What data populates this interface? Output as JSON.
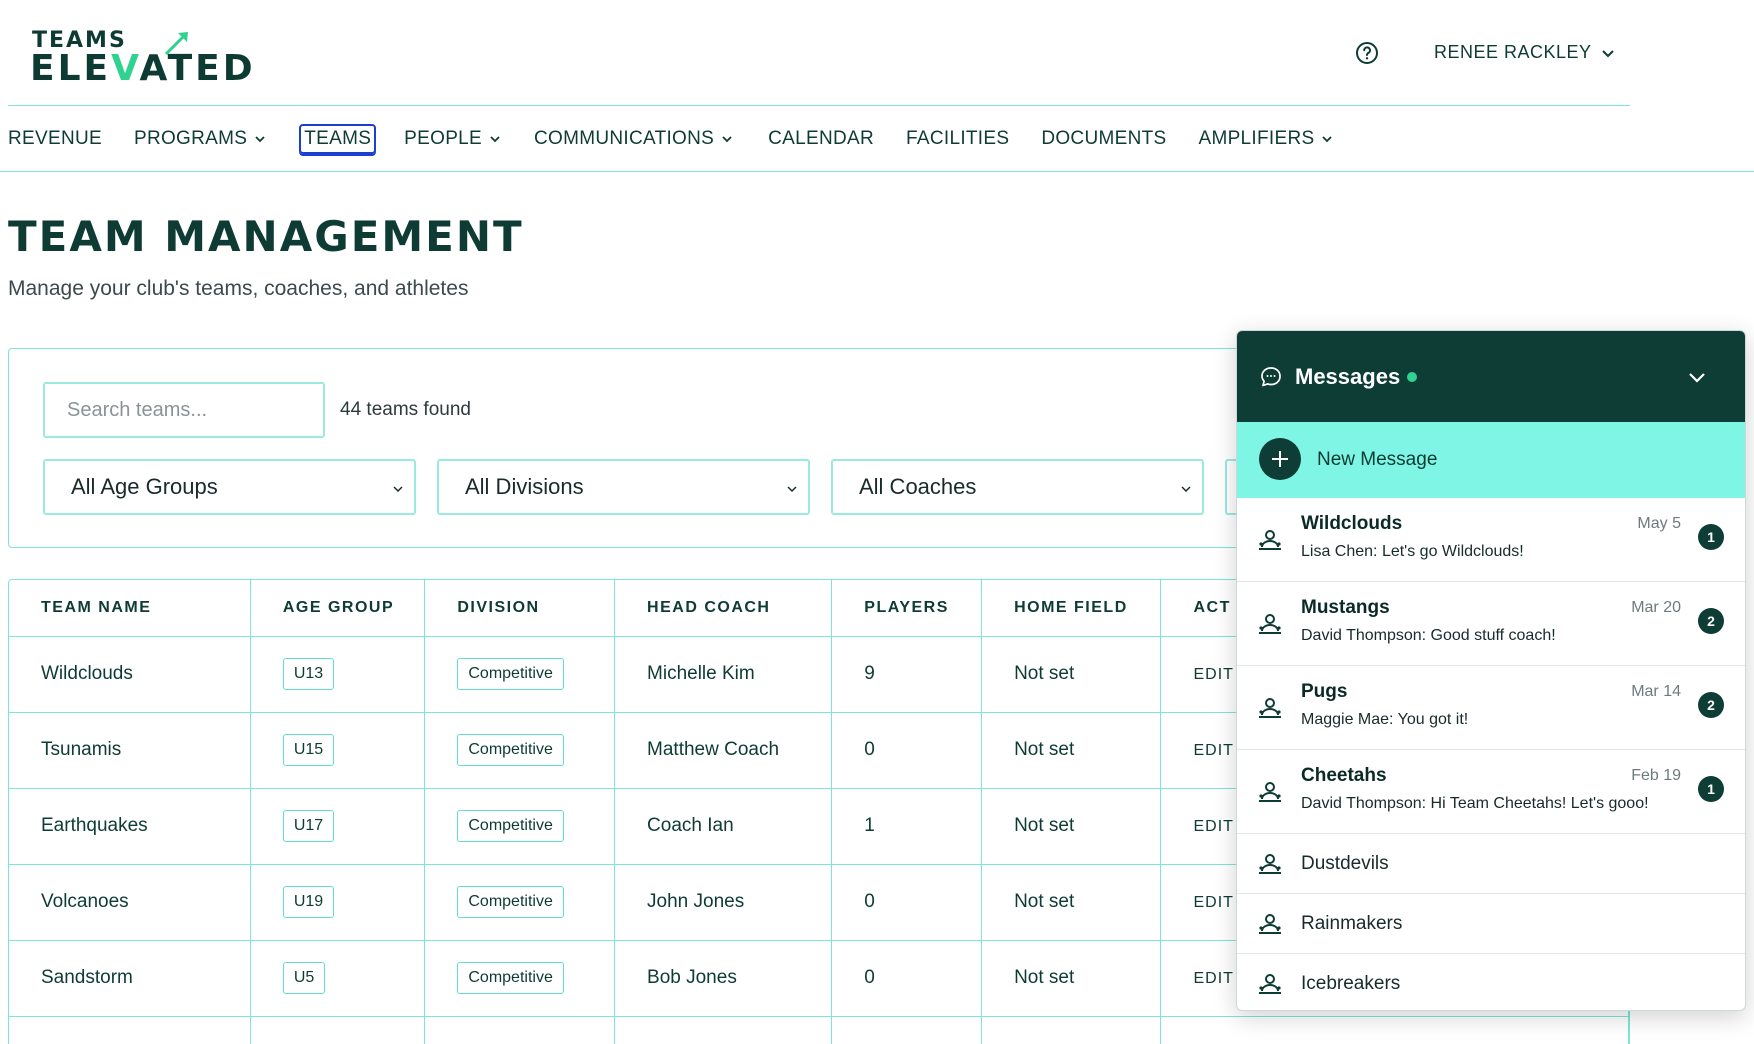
{
  "brand": {
    "logo_top": "TEAMS",
    "logo_bottom_a": "ELE",
    "logo_bottom_v": "V",
    "logo_bottom_b": "ATED"
  },
  "header": {
    "user_name": "RENEE RACKLEY"
  },
  "nav": {
    "items": [
      {
        "label": "REVENUE"
      },
      {
        "label": "PROGRAMS"
      },
      {
        "label": "TEAMS"
      },
      {
        "label": "PEOPLE"
      },
      {
        "label": "COMMUNICATIONS"
      },
      {
        "label": "CALENDAR"
      },
      {
        "label": "FACILITIES"
      },
      {
        "label": "DOCUMENTS"
      },
      {
        "label": "AMPLIFIERS"
      }
    ],
    "active": "TEAMS"
  },
  "page": {
    "title": "TEAM MANAGEMENT",
    "subtitle": "Manage your club's teams, coaches, and athletes"
  },
  "filters": {
    "search_placeholder": "Search teams...",
    "search_value": "",
    "count_text": "44 teams found",
    "age_group": "All Age Groups",
    "division": "All Divisions",
    "coach": "All Coaches"
  },
  "table": {
    "headers": [
      "TEAM NAME",
      "AGE GROUP",
      "DIVISION",
      "HEAD COACH",
      "PLAYERS",
      "HOME FIELD",
      "ACT"
    ],
    "rows": [
      {
        "team": "Wildclouds",
        "age": "U13",
        "division": "Competitive",
        "coach": "Michelle Kim",
        "players": "9",
        "field": "Not set",
        "action": "EDIT"
      },
      {
        "team": "Tsunamis",
        "age": "U15",
        "division": "Competitive",
        "coach": "Matthew Coach",
        "players": "0",
        "field": "Not set",
        "action": "EDIT"
      },
      {
        "team": "Earthquakes",
        "age": "U17",
        "division": "Competitive",
        "coach": "Coach Ian",
        "players": "1",
        "field": "Not set",
        "action": "EDIT"
      },
      {
        "team": "Volcanoes",
        "age": "U19",
        "division": "Competitive",
        "coach": "John Jones",
        "players": "0",
        "field": "Not set",
        "action": "EDIT"
      },
      {
        "team": "Sandstorm",
        "age": "U5",
        "division": "Competitive",
        "coach": "Bob Jones",
        "players": "0",
        "field": "Not set",
        "action": "EDIT"
      }
    ]
  },
  "messages": {
    "title": "Messages",
    "online_color": "#2fd38f",
    "new_message_label": "New Message",
    "threads": [
      {
        "name": "Wildclouds",
        "date": "May 5",
        "preview": "Lisa Chen: Let's go Wildclouds!",
        "unread": "1"
      },
      {
        "name": "Mustangs",
        "date": "Mar 20",
        "preview": "David Thompson: Good stuff coach!",
        "unread": "2"
      },
      {
        "name": "Pugs",
        "date": "Mar 14",
        "preview": "Maggie Mae: You got it!",
        "unread": "2"
      },
      {
        "name": "Cheetahs",
        "date": "Feb 19",
        "preview": "David Thompson: Hi Team Cheetahs! Let's gooo!",
        "unread": "1"
      },
      {
        "name": "Dustdevils"
      },
      {
        "name": "Rainmakers"
      },
      {
        "name": "Icebreakers"
      }
    ]
  },
  "colors": {
    "brand_dark": "#0d3d35",
    "accent": "#2fd38f",
    "border": "#7ee6d6",
    "new_message_bg": "#7ef5e5"
  }
}
